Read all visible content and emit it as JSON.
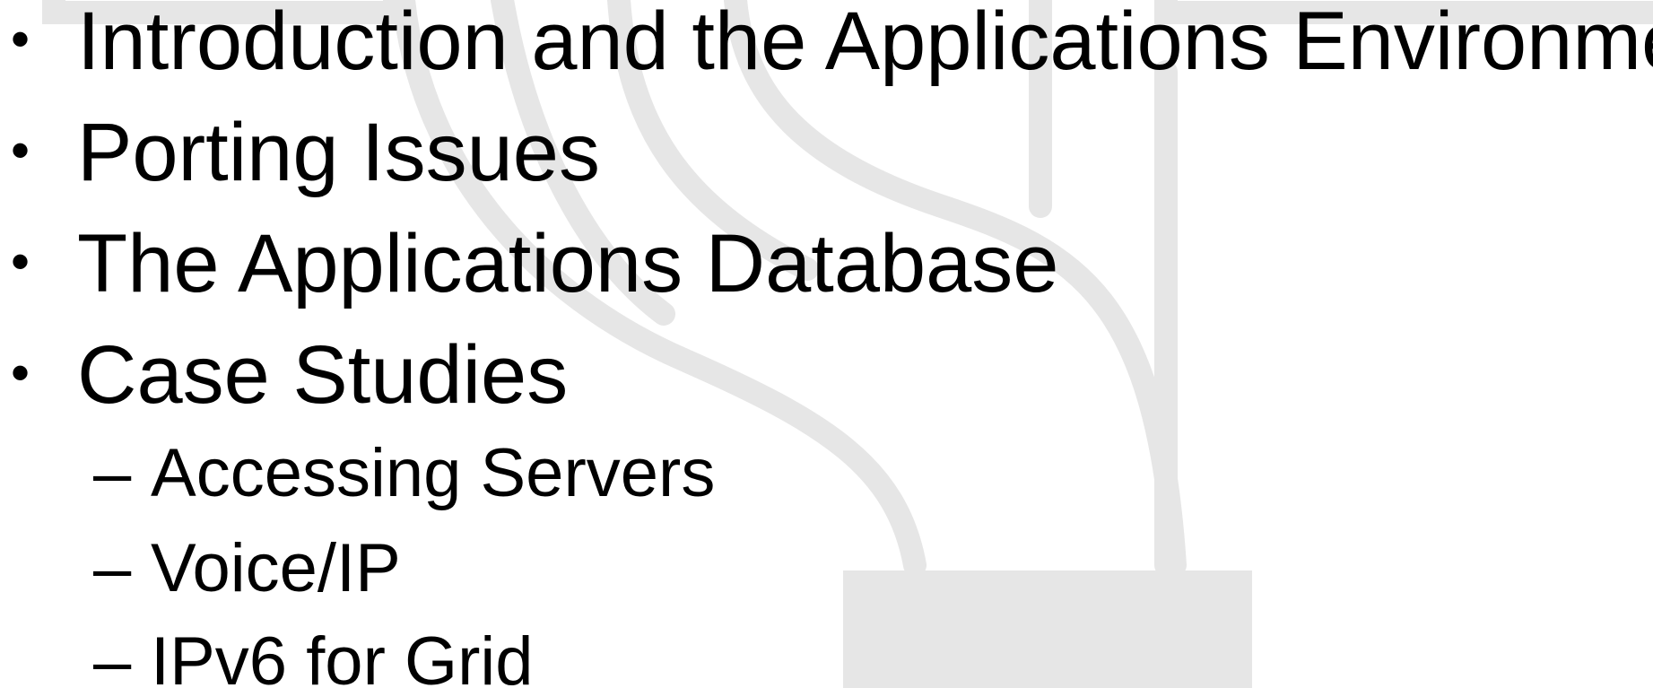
{
  "colors": {
    "background": "#ffffff",
    "text": "#000000",
    "watermark": "#e6e6e6"
  },
  "bullets": [
    {
      "marker": "•",
      "text": "Introduction and the Applications Environment"
    },
    {
      "marker": "•",
      "text": "Porting Issues"
    },
    {
      "marker": "•",
      "text": "The Applications Database"
    },
    {
      "marker": "•",
      "text": "Case Studies"
    }
  ],
  "sub_bullets": [
    {
      "marker": "–",
      "text": "Accessing Servers"
    },
    {
      "marker": "–",
      "text": "Voice/IP"
    },
    {
      "marker": "–",
      "text": "IPv6 for Grid"
    }
  ]
}
